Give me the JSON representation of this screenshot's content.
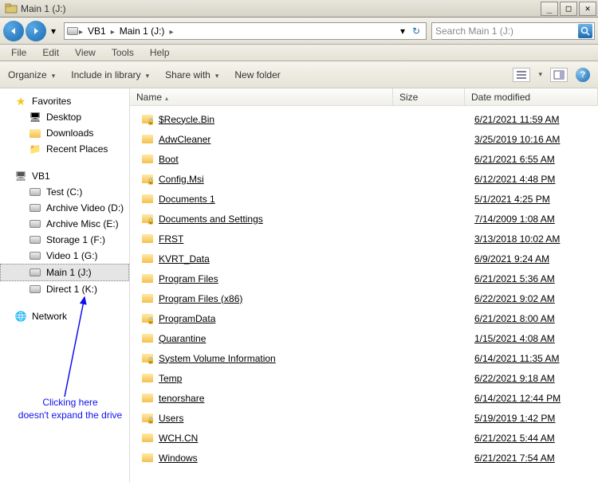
{
  "window": {
    "title": "Main 1 (J:)",
    "min": "_",
    "max": "□",
    "close": "✕"
  },
  "breadcrumb": {
    "items": [
      "VB1",
      "Main 1 (J:)"
    ]
  },
  "search": {
    "placeholder": "Search Main 1 (J:)"
  },
  "menus": [
    "File",
    "Edit",
    "View",
    "Tools",
    "Help"
  ],
  "toolbar": {
    "organize": "Organize",
    "include": "Include in library",
    "share": "Share with",
    "newfolder": "New folder"
  },
  "nav": {
    "favorites": {
      "label": "Favorites",
      "items": [
        "Desktop",
        "Downloads",
        "Recent Places"
      ]
    },
    "computer": {
      "label": "VB1",
      "drives": [
        {
          "label": "Test (C:)"
        },
        {
          "label": "Archive Video (D:)"
        },
        {
          "label": "Archive Misc (E:)"
        },
        {
          "label": "Storage 1 (F:)"
        },
        {
          "label": "Video 1 (G:)"
        },
        {
          "label": "Main 1 (J:)",
          "selected": true
        },
        {
          "label": "Direct 1 (K:)"
        }
      ]
    },
    "network": {
      "label": "Network"
    }
  },
  "columns": {
    "name": "Name",
    "size": "Size",
    "date": "Date modified"
  },
  "files": [
    {
      "name": "$Recycle.Bin",
      "date": "6/21/2021 11:59 AM",
      "locked": true
    },
    {
      "name": "AdwCleaner",
      "date": "3/25/2019 10:16 AM",
      "locked": false
    },
    {
      "name": "Boot",
      "date": "6/21/2021 6:55 AM",
      "locked": false
    },
    {
      "name": "Config.Msi",
      "date": "6/12/2021 4:48 PM",
      "locked": true
    },
    {
      "name": "Documents 1",
      "date": "5/1/2021 4:25 PM",
      "locked": false
    },
    {
      "name": "Documents and Settings",
      "date": "7/14/2009 1:08 AM",
      "locked": true
    },
    {
      "name": "FRST",
      "date": "3/13/2018 10:02 AM",
      "locked": false
    },
    {
      "name": "KVRT_Data",
      "date": "6/9/2021 9:24 AM",
      "locked": false
    },
    {
      "name": "Program Files",
      "date": "6/21/2021 5:36 AM",
      "locked": false
    },
    {
      "name": "Program Files (x86)",
      "date": "6/22/2021 9:02 AM",
      "locked": false
    },
    {
      "name": "ProgramData",
      "date": "6/21/2021 8:00 AM",
      "locked": true
    },
    {
      "name": "Quarantine",
      "date": "1/15/2021 4:08 AM",
      "locked": false
    },
    {
      "name": "System Volume Information",
      "date": "6/14/2021 11:35 AM",
      "locked": true
    },
    {
      "name": "Temp",
      "date": "6/22/2021 9:18 AM",
      "locked": false
    },
    {
      "name": "tenorshare",
      "date": "6/14/2021 12:44 PM",
      "locked": false
    },
    {
      "name": "Users",
      "date": "5/19/2019 1:42 PM",
      "locked": true
    },
    {
      "name": "WCH.CN",
      "date": "6/21/2021 5:44 AM",
      "locked": false
    },
    {
      "name": "Windows",
      "date": "6/21/2021 7:54 AM",
      "locked": false
    }
  ],
  "annotation": {
    "line1": "Clicking here",
    "line2": "doesn't expand the drive"
  }
}
